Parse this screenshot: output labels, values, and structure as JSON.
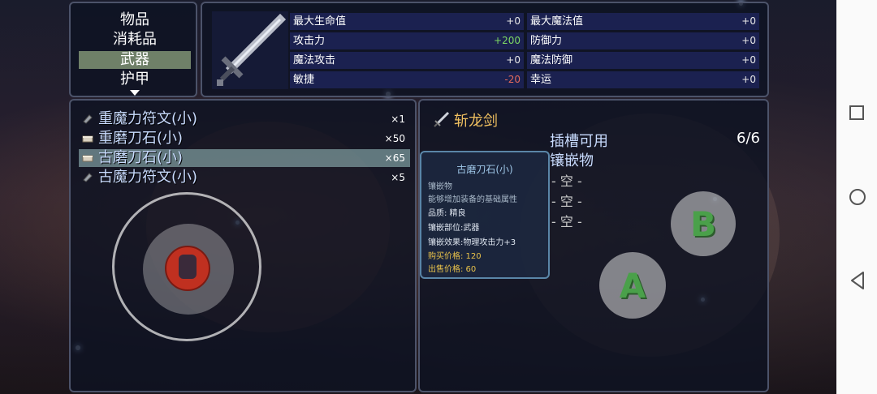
{
  "menu": {
    "categories": [
      "物品",
      "消耗品",
      "武器",
      "护甲"
    ],
    "selected_index": 2
  },
  "stats": [
    {
      "label": "最大生命值",
      "value": "+0"
    },
    {
      "label": "最大魔法值",
      "value": "+0"
    },
    {
      "label": "攻击力",
      "value": "+200"
    },
    {
      "label": "防御力",
      "value": "+0"
    },
    {
      "label": "魔法攻击",
      "value": "+0"
    },
    {
      "label": "魔法防御",
      "value": "+0"
    },
    {
      "label": "敏捷",
      "value": "-20"
    },
    {
      "label": "幸运",
      "value": "+0"
    }
  ],
  "items": [
    {
      "name": "重魔力符文(小)",
      "count": "×1",
      "icon": "rune-icon"
    },
    {
      "name": "重磨刀石(小)",
      "count": "×50",
      "icon": "whetstone-icon"
    },
    {
      "name": "古磨刀石(小)",
      "count": "×65",
      "icon": "whetstone-icon"
    },
    {
      "name": "古魔力符文(小)",
      "count": "×5",
      "icon": "rune-icon"
    }
  ],
  "selected_item_index": 2,
  "detail": {
    "weapon_name": "斩龙剑",
    "slot_label": "插槽可用",
    "slot_count": "6/6",
    "inlay_label": "镶嵌物",
    "empty_slots": [
      "- 空 -",
      "- 空 -",
      "- 空 -"
    ]
  },
  "tooltip": {
    "title": "古磨刀石(小)",
    "type": "镶嵌物",
    "desc": "能够增加装备的基础属性",
    "quality": "品质: 精良",
    "part": "镶嵌部位:武器",
    "effect": "镶嵌效果:物理攻击力+3",
    "buy": "购买价格: 120",
    "sell": "出售价格: 60"
  },
  "buttons": {
    "a": "A",
    "b": "B"
  },
  "colors": {
    "selected_row": "#6f8068",
    "positive": "#7dd864",
    "negative": "#e26a5c",
    "weapon_name": "#f0c060"
  }
}
